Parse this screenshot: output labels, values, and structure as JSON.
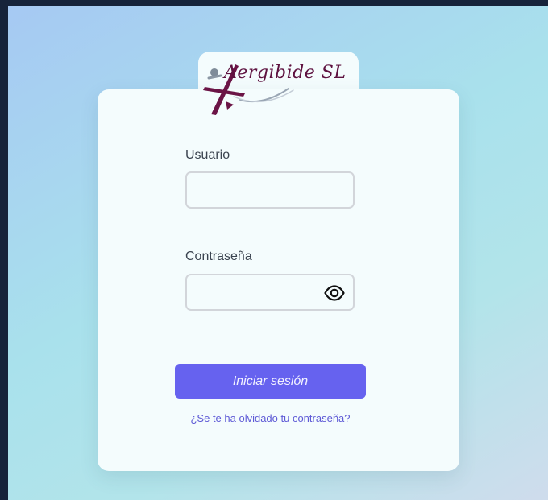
{
  "brand": {
    "name": "Aergibide SL",
    "logo_icon": "airplane-logo-icon",
    "color": "#5e1240"
  },
  "form": {
    "username_label": "Usuario",
    "username_value": "",
    "password_label": "Contraseña",
    "password_value": "",
    "password_toggle_icon": "eye-icon",
    "submit_label": "Iniciar sesión",
    "forgot_link": "¿Se te ha olvidado tu contraseña?"
  },
  "colors": {
    "accent": "#6662ef",
    "link": "#5e5ad6",
    "card": "#f4fcfd"
  }
}
